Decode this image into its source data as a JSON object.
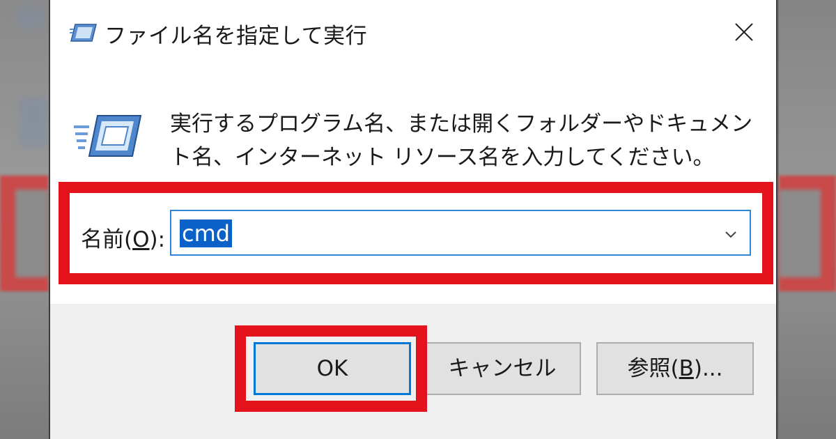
{
  "dialog": {
    "title": "ファイル名を指定して実行",
    "description": "実行するプログラム名、または開くフォルダーやドキュメント名、インターネット リソース名を入力してください。",
    "name_label_pre": "名前(",
    "name_label_key": "O",
    "name_label_post": "):",
    "name_value": "cmd"
  },
  "buttons": {
    "ok": "OK",
    "cancel": "キャンセル",
    "browse_pre": "参照(",
    "browse_key": "B",
    "browse_post": ")..."
  },
  "icons": {
    "title": "run-icon",
    "main": "run-icon",
    "close": "close-icon",
    "dropdown": "chevron-down-icon"
  },
  "colors": {
    "highlight": "#e3121b",
    "selection": "#0a62c8",
    "focus_border": "#0078d7"
  }
}
